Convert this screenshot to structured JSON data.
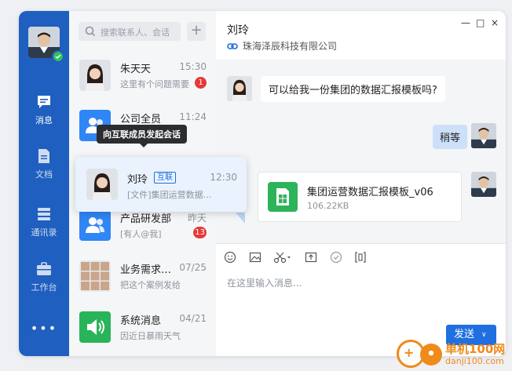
{
  "colors": {
    "nav": "#1f5fc0",
    "accent": "#1f6fe0",
    "badge": "#e53935",
    "online": "#2fc25b",
    "file": "#2db359"
  },
  "nav": {
    "items": [
      {
        "label": "消息",
        "icon": "message-icon",
        "active": true
      },
      {
        "label": "文档",
        "icon": "document-icon",
        "active": false
      },
      {
        "label": "通讯录",
        "icon": "contacts-icon",
        "active": false
      },
      {
        "label": "工作台",
        "icon": "workbench-icon",
        "active": false
      }
    ],
    "more": "•••"
  },
  "search": {
    "placeholder": "搜索联系人、会话"
  },
  "conversations": [
    {
      "name": "朱天天",
      "time": "15:30",
      "preview": "这里有个问题需要",
      "badge": "1",
      "avatar": "person-female-avatar"
    },
    {
      "name": "公司全员",
      "time": "11:24",
      "preview": "",
      "badge": "",
      "avatar": "group-avatar"
    },
    {
      "name": "产品研发部",
      "time": "昨天",
      "preview": "[有人@我]",
      "badge": "13",
      "avatar": "group-avatar"
    },
    {
      "name": "业务需求…",
      "time": "07/25",
      "preview": "把这个案例发给",
      "badge": "",
      "avatar": "group-photo-avatar"
    },
    {
      "name": "系统消息",
      "time": "04/21",
      "preview": "因近日暴雨天气",
      "badge": "",
      "avatar": "speaker-icon"
    }
  ],
  "tooltip": "向互联成员发起会话",
  "hover_card": {
    "name": "刘玲",
    "tag": "互联",
    "time": "12:30",
    "preview": "[文件]集团运营数据…"
  },
  "chat": {
    "title": "刘玲",
    "org": "珠海泽辰科技有限公司",
    "window_controls": [
      "—",
      "□",
      "×"
    ],
    "messages": [
      {
        "from": "other",
        "text": "可以给我一份集团的数据汇报模板吗?"
      },
      {
        "from": "me",
        "text": "稍等"
      },
      {
        "from": "me",
        "type": "file",
        "filename": "集团运营数据汇报模板_v06",
        "size": "106.22KB"
      }
    ],
    "toolbar": [
      "emoji-icon",
      "image-icon",
      "scissors-icon",
      "upload-icon",
      "check-circle-icon",
      "bracket-icon"
    ],
    "input_placeholder": "在这里输入消息...",
    "send_label": "发送",
    "send_dropdown": "∨"
  },
  "watermark": {
    "title": "单机100网",
    "url": "danji100.com"
  }
}
